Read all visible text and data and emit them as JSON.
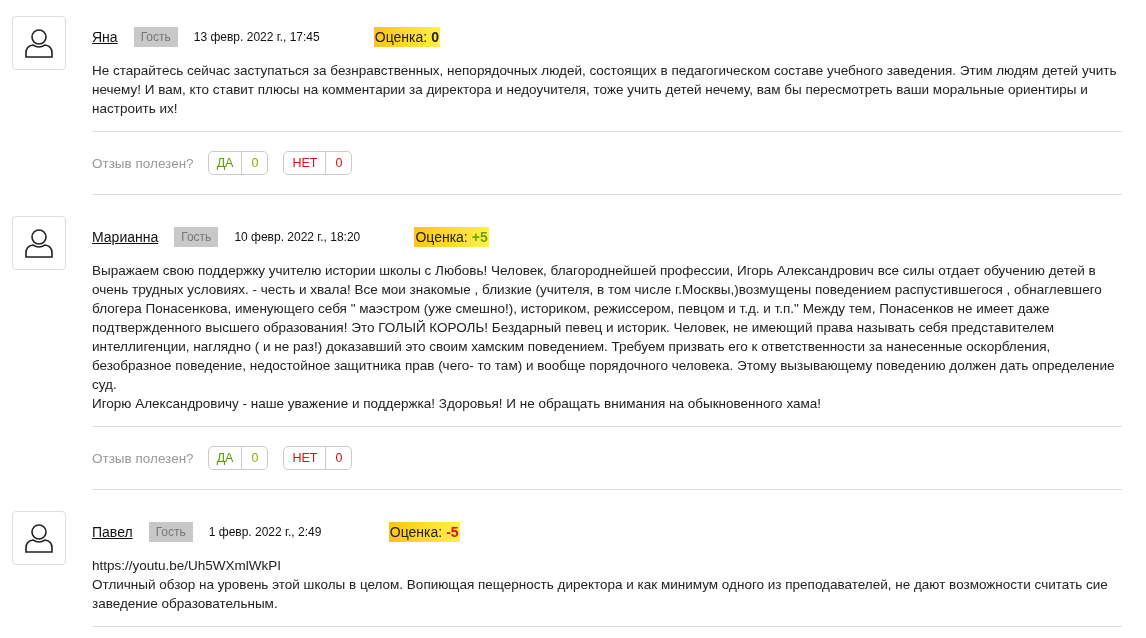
{
  "reviews": [
    {
      "author": "Яна",
      "role": "Гость",
      "date": "13 февр. 2022 г., 17:45",
      "rating": {
        "label": "Оценка:",
        "value": "0",
        "kind": "neutral"
      },
      "text": "Не старайтесь сейчас заступаться за безнравственных, непорядочных людей, состоящих в педагогическом составе учебного заведения. Этим людям детей учить нечему! И вам, кто ставит плюсы на комментарии за директора и недоучителя, тоже учить детей нечему, вам бы пересмотреть ваши моральные ориентиры и настроить их!",
      "feedback": {
        "question": "Отзыв полезен?",
        "yes_label": "ДА",
        "yes_count": "0",
        "no_label": "НЕТ",
        "no_count": "0"
      }
    },
    {
      "author": "Марианна",
      "role": "Гость",
      "date": "10 февр. 2022 г., 18:20",
      "rating": {
        "label": "Оценка:",
        "value": "+5",
        "kind": "positive"
      },
      "text": "Выражаем свою поддержку учителю истории школы с Любовь! Человек, благороднейшей профессии, Игорь Александрович все силы отдает обучению детей в очень трудных условиях. - честь и хвала! Все мои знакомые , близкие (учителя, в том числе г.Москвы,)возмущены поведением распустившегося , обнаглевшего блогера Понасенкова, именующего себя \" маэстром (уже смешно!), историком, режиссером, певцом и т.д. и т.п.\" Между тем, Понасенков не имеет даже подтвержденного высшего образования! Это ГОЛЫЙ КОРОЛЬ! Бездарный певец и историк. Человек, не имеющий права называть себя представителем интеллигенции, наглядно ( и не раз!) доказавший это своим хамским поведением. Требуем призвать его к ответственности за нанесенные оскорбления, безобразное поведение, недостойное защитника прав (чего- то там) и вообще порядочного человека. Этому вызывающему поведению должен дать определение суд.\nИгорю Александровичу - наше уважение и поддержка! Здоровья! И не обращать внимания на обыкновенного хама!",
      "feedback": {
        "question": "Отзыв полезен?",
        "yes_label": "ДА",
        "yes_count": "0",
        "no_label": "НЕТ",
        "no_count": "0"
      }
    },
    {
      "author": "Павел",
      "role": "Гость",
      "date": "1 февр. 2022 г., 2:49",
      "rating": {
        "label": "Оценка:",
        "value": "-5",
        "kind": "negative"
      },
      "text": "https://youtu.be/Uh5WXmlWkPI\nОтличный обзор на уровень этой школы в целом. Вопиющая пещерность директора и как минимум одного из преподавателей, не дают возможности считать сие заведение образовательным."
    }
  ]
}
